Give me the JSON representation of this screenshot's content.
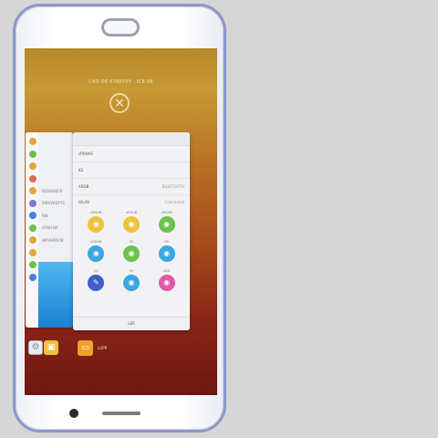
{
  "screen_header": {
    "text": "CAO DE 6TREPPY · ICE 08",
    "close_glyph": "×"
  },
  "back_card": {
    "rows": [
      {
        "label": "",
        "color": "#e5a43a"
      },
      {
        "label": "",
        "color": "#6cc24a"
      },
      {
        "label": "",
        "color": "#e5a43a"
      },
      {
        "label": "",
        "color": "#e06a5a"
      },
      {
        "label": "WSVHSEFR",
        "color": "#e5a43a"
      },
      {
        "label": "SWVVKDFYS",
        "color": "#7b7ad8"
      },
      {
        "label": "RW",
        "color": "#4a7fd6"
      },
      {
        "label": "VFW-UW",
        "color": "#6cc24a"
      },
      {
        "label": "WFVHFDFW",
        "color": "#e5a43a"
      },
      {
        "label": "",
        "color": "#e5a43a"
      },
      {
        "label": "",
        "color": "#6cc24a"
      },
      {
        "label": "",
        "color": "#4a7fd6"
      }
    ]
  },
  "settings_card": {
    "rows": [
      {
        "label": "sPDHAS",
        "value": ""
      },
      {
        "label": "KS",
        "value": ""
      },
      {
        "label": "ARDB",
        "value": "BLUETOOTH"
      }
    ],
    "section": {
      "label": "WLAN",
      "value": "Connected"
    },
    "tiles": [
      {
        "label": "APDHB",
        "icon": "wifi-icon",
        "glyph": "◉",
        "color": "#f0c23b"
      },
      {
        "label": "APDHB",
        "icon": "bluetooth-icon",
        "glyph": "◉",
        "color": "#f0c23b"
      },
      {
        "label": "APDHB",
        "icon": "data-icon",
        "glyph": "◉",
        "color": "#6cc24a"
      },
      {
        "label": "ASDHB",
        "icon": "hotspot-icon",
        "glyph": "◉",
        "color": "#3aa7e0"
      },
      {
        "label": "KS",
        "icon": "location-icon",
        "glyph": "◉",
        "color": "#6cc24a"
      },
      {
        "label": "HS",
        "icon": "sync-icon",
        "glyph": "◉",
        "color": "#3aa7e0"
      },
      {
        "label": "HS",
        "icon": "torch-icon",
        "glyph": "✎",
        "color": "#3f5fc8"
      },
      {
        "label": "HS",
        "icon": "screenshot-icon",
        "glyph": "◉",
        "color": "#3aa7e0"
      },
      {
        "label": "ASD",
        "icon": "rotation-icon",
        "glyph": "◉",
        "color": "#e05aa6"
      }
    ],
    "footer": "LBR"
  },
  "dock": {
    "gear_glyph": "⚙",
    "yellow_glyph": "▣",
    "app_glyph": "▭",
    "app_label": "LOPP"
  }
}
